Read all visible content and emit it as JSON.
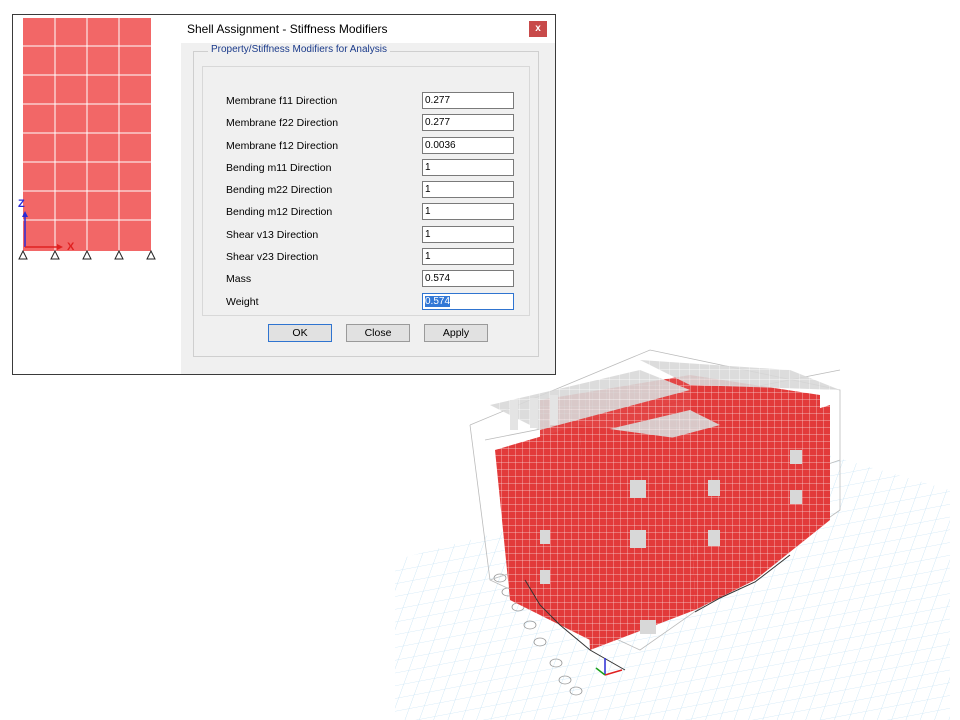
{
  "dialog": {
    "title": "Shell Assignment - Stiffness Modifiers",
    "close_glyph": "x",
    "group_title": "Property/Stiffness Modifiers for Analysis",
    "rows": [
      {
        "label": "Membrane f11 Direction",
        "value": "0.277"
      },
      {
        "label": "Membrane f22 Direction",
        "value": "0.277"
      },
      {
        "label": "Membrane f12 Direction",
        "value": "0.0036"
      },
      {
        "label": "Bending m11 Direction",
        "value": "1"
      },
      {
        "label": "Bending m22 Direction",
        "value": "1"
      },
      {
        "label": "Bending m12 Direction",
        "value": "1"
      },
      {
        "label": "Shear v13 Direction",
        "value": "1"
      },
      {
        "label": "Shear v23 Direction",
        "value": "1"
      },
      {
        "label": "Mass",
        "value": "0.574"
      },
      {
        "label": "Weight",
        "value": "0.574"
      }
    ],
    "buttons": {
      "ok": "OK",
      "close": "Close",
      "apply": "Apply"
    }
  },
  "elevation": {
    "axis_z": "Z",
    "axis_x": "X",
    "wall_color": "#f26767"
  },
  "model3d": {
    "wall_color": "#e23a3a",
    "grid_color": "#bfe0f4",
    "slab_color": "#d8d8d8"
  }
}
